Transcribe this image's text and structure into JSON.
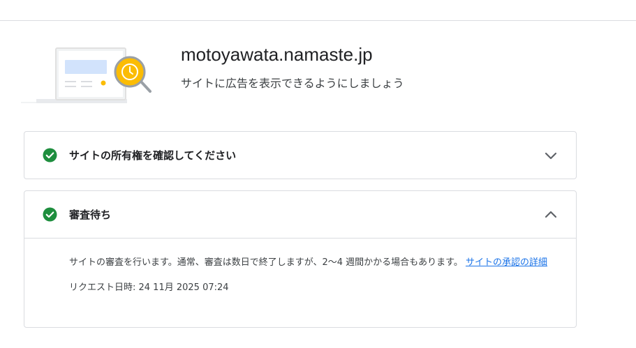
{
  "site": {
    "domain": "motoyawata.namaste.jp",
    "subtitle": "サイトに広告を表示できるようにしましょう"
  },
  "steps": [
    {
      "title": "サイトの所有権を確認してください",
      "status_icon": "check-circle-icon",
      "expander_icon": "chevron-down-icon",
      "expanded": false
    },
    {
      "title": "審査待ち",
      "status_icon": "check-circle-icon",
      "expander_icon": "chevron-up-icon",
      "expanded": true,
      "description": "サイトの審査を行います。通常、審査は数日で終了しますが、2〜4 週間かかる場合もあります。",
      "link_text": "サイトの承認の詳細",
      "request_date_label": "リクエスト日時: 24 11月 2025 07:24"
    }
  ],
  "colors": {
    "success": "#1e8e3e",
    "link": "#1a73e8",
    "border": "#dadce0",
    "accent_yellow": "#fbbc04"
  }
}
